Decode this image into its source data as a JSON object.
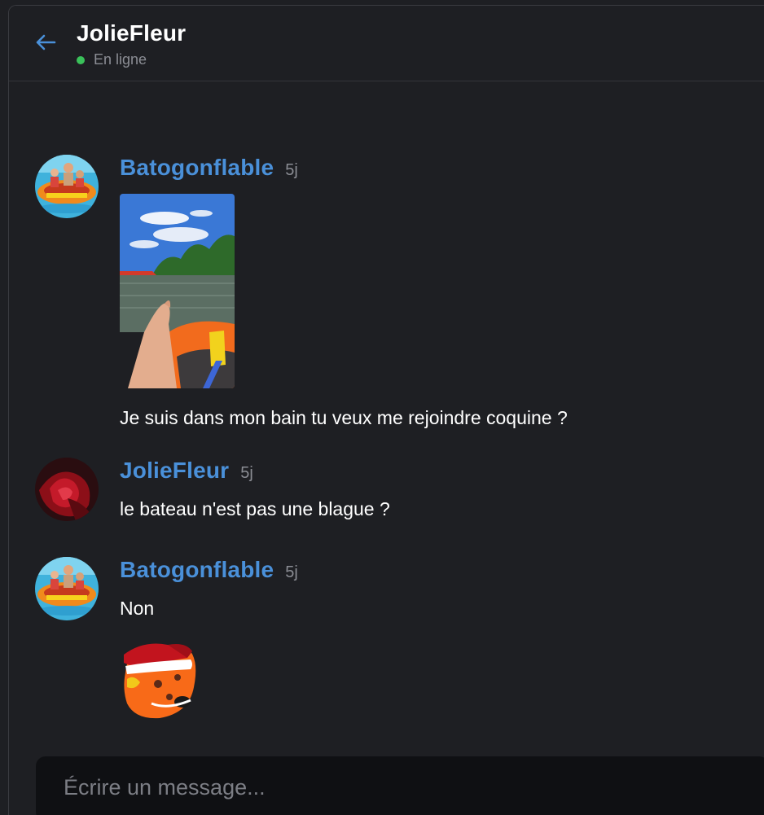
{
  "header": {
    "contact_name": "JolieFleur",
    "status": "En ligne",
    "status_color": "#3ac15a"
  },
  "messages": [
    {
      "author": "Batogonflable",
      "time": "5j",
      "avatar": "inflatable-boat-avatar",
      "attachment": "boat-lake-photo",
      "text": "Je suis dans mon bain tu veux me rejoindre coquine ?"
    },
    {
      "author": "JolieFleur",
      "time": "5j",
      "avatar": "red-flower-avatar",
      "text": "le bateau n'est pas une blague ?"
    },
    {
      "author": "Batogonflable",
      "time": "5j",
      "avatar": "inflatable-boat-avatar",
      "text": "Non",
      "attachment": "boat-santa-hat-sticker"
    }
  ],
  "composer": {
    "placeholder": "Écrire un message..."
  },
  "colors": {
    "background": "#1e1f23",
    "author": "#4a90d9",
    "accent": "#4a90d9"
  }
}
